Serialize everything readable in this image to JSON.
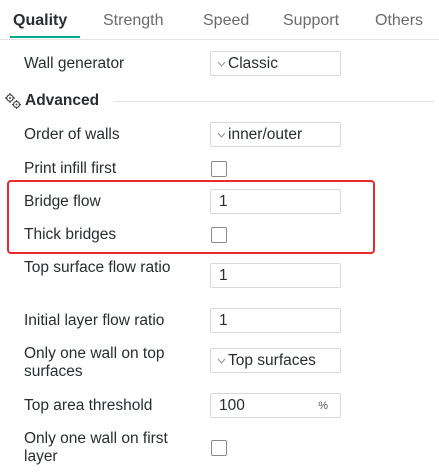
{
  "tabs": [
    {
      "label": "Quality",
      "active": true
    },
    {
      "label": "Strength",
      "active": false
    },
    {
      "label": "Speed",
      "active": false
    },
    {
      "label": "Support",
      "active": false
    },
    {
      "label": "Others",
      "active": false
    }
  ],
  "wall_generator": {
    "label": "Wall generator",
    "value": "Classic"
  },
  "advanced": {
    "title": "Advanced",
    "icon": "gear-cluster-icon"
  },
  "settings": {
    "order_of_walls": {
      "label": "Order of walls",
      "value": "inner/outer"
    },
    "print_infill_first": {
      "label": "Print infill first",
      "checked": false
    },
    "bridge_flow": {
      "label": "Bridge flow",
      "value": "1"
    },
    "thick_bridges": {
      "label": "Thick bridges",
      "checked": false
    },
    "top_surface_flow_ratio": {
      "label": "Top surface flow ratio",
      "value": "1"
    },
    "initial_layer_flow_ratio": {
      "label": "Initial layer flow ratio",
      "value": "1"
    },
    "only_one_wall_top": {
      "label": "Only one wall on top surfaces",
      "value": "Top surfaces"
    },
    "top_area_threshold": {
      "label": "Top area threshold",
      "value": "100",
      "unit": "%"
    },
    "only_one_wall_first_layer": {
      "label": "Only one wall on first layer",
      "checked": false
    }
  },
  "colors": {
    "accent": "#00a98f",
    "highlight": "#e8292e",
    "text": "#262e30",
    "tab_inactive": "#6b6b6b"
  }
}
